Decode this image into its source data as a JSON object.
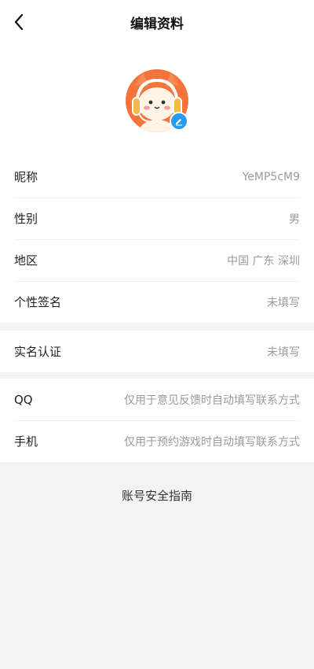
{
  "header": {
    "title": "编辑资料",
    "back_icon": "chevron-left-icon"
  },
  "profile": {
    "avatar_icon": "fox-avatar",
    "edit_icon": "pencil-icon"
  },
  "basic_info": [
    {
      "label": "昵称",
      "value": "YeMP5cM9"
    },
    {
      "label": "性别",
      "value": "男"
    },
    {
      "label": "地区",
      "value": "中国 广东 深圳"
    },
    {
      "label": "个性签名",
      "value": "未填写"
    }
  ],
  "verification": [
    {
      "label": "实名认证",
      "value": "未填写"
    }
  ],
  "contact": [
    {
      "label": "QQ",
      "value": "仅用于意见反馈时自动填写联系方式"
    },
    {
      "label": "手机",
      "value": "仅用于预约游戏时自动填写联系方式"
    }
  ],
  "footer": {
    "guide_link": "账号安全指南"
  },
  "colors": {
    "accent": "#2a9cf0",
    "avatar_orange": "#f6733a",
    "separator_bg": "#f3f3f3"
  }
}
